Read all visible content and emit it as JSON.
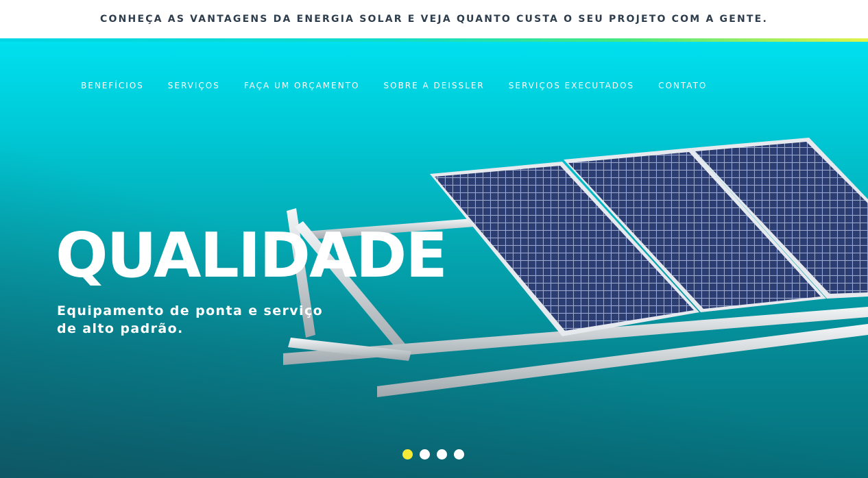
{
  "top_banner": {
    "text": "CONHEÇA AS VANTAGENS DA ENERGIA SOLAR E VEJA QUANTO CUSTA O SEU PROJETO COM A GENTE."
  },
  "nav": {
    "items": [
      {
        "label": "BENEFÍCIOS"
      },
      {
        "label": "SERVIÇOS"
      },
      {
        "label": "FAÇA UM ORÇAMENTO"
      },
      {
        "label": "SOBRE A DEISSLER"
      },
      {
        "label": "SERVIÇOS EXECUTADOS"
      },
      {
        "label": "CONTATO"
      }
    ]
  },
  "hero": {
    "headline": "QUALIDADE",
    "subline": "Equipamento de ponta e serviço de alto padrão.",
    "image": "solar-panel-array-on-aluminum-frame"
  },
  "carousel": {
    "slide_count": 4,
    "active_index": 0
  },
  "colors": {
    "banner_text": "#2e3d4c",
    "hero_top": "#00e0ef",
    "hero_bottom": "#066f7a",
    "active_dot": "#f4ea37"
  }
}
